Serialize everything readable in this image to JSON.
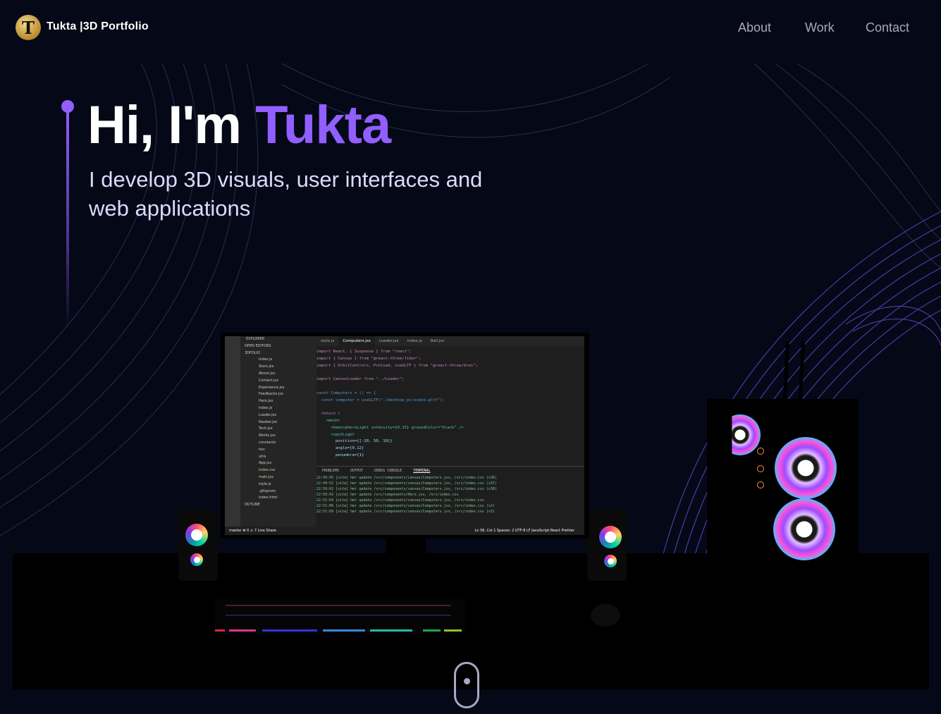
{
  "nav": {
    "logo_letter": "T",
    "brand": "Tukta |3D Portfolio",
    "links": [
      "About",
      "Work",
      "Contact"
    ]
  },
  "hero": {
    "greeting": "Hi, I'm ",
    "name": "Tukta",
    "subtitle": "I develop 3D visuals, user interfaces and web applications"
  },
  "colors": {
    "background": "#050816",
    "accent": "#915eff",
    "nav_text": "#aaa6c3"
  },
  "editor": {
    "tabs": [
      "style.js",
      "Computers.jsx",
      "Loader.jsx",
      "index.js",
      "Ball.jsx"
    ],
    "explorer_header": "EXPLORER",
    "explorer_items": [
      "OPEN EDITORS",
      "3DFOLIO",
      "index.js",
      "Stars.jsx",
      "About.jsx",
      "Contact.jsx",
      "Experience.jsx",
      "Feedbacks.jsx",
      "Hero.jsx",
      "index.js",
      "Loader.jsx",
      "Navbar.jsx",
      "Tech.jsx",
      "Works.jsx",
      "constants",
      "hoc",
      "utils",
      "App.jsx",
      "index.css",
      "main.jsx",
      "style.js",
      ".gitignore",
      "index.html",
      "OUTLINE"
    ],
    "code_lines": [
      "import React, { Suspense } from \"react\";",
      "import { Canvas } from \"@react-three/fiber\";",
      "import { OrbitControls, Preload, useGLTF } from \"@react-three/drei\";",
      "",
      "import CanvasLoader from \"../Loader\";",
      "",
      "const Computers = () => {",
      "  const computer = useGLTF(\"./desktop_pc/scene.gltf\");",
      "",
      "  return (",
      "    <mesh>",
      "      <hemisphereLight intensity={0.15} groundColor=\"black\" />",
      "      <spotLight",
      "        position={[-20, 50, 10]}",
      "        angle={0.12}",
      "        penumbra={1}"
    ],
    "panel_tabs": [
      "PROBLEMS",
      "OUTPUT",
      "DEBUG CONSOLE",
      "TERMINAL"
    ],
    "terminal_lines": [
      "22:49:45 [vite] hmr update /src/components/canvas/Computers.jsx, /src/index.css (x36)",
      "22:49:52 [vite] hmr update /src/components/canvas/Computers.jsx, /src/index.css (x37)",
      "22:50:02 [vite] hmr update /src/components/canvas/Computers.jsx, /src/index.css (x38)",
      "22:50:42 [vite] hmr update /src/components/Hero.jsx, /src/index.css",
      "22:51:04 [vite] hmr update /src/components/canvas/Computers.jsx, /src/index.css",
      "22:51:06 [vite] hmr update /src/components/canvas/Computers.jsx, /src/index.css (x2)",
      "22:51:09 [vite] hmr update /src/components/canvas/Computers.jsx, /src/index.css (x3)"
    ],
    "status_left": "master  ⊗ 0 ⚠ 7  Live Share",
    "status_right": "Ln 56, Col 1  Spaces: 2  UTF-8  LF  JavaScript React  Prettier"
  }
}
